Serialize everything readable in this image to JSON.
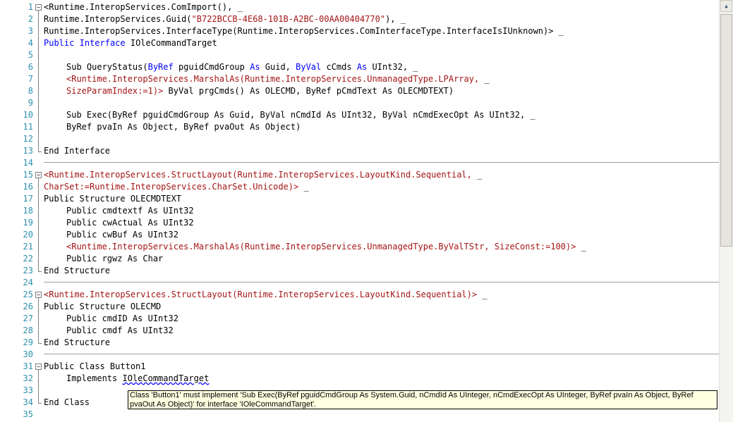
{
  "editor": {
    "lines": [
      {
        "n": "1",
        "text": "<Runtime.InteropServices.ComImport(), _"
      },
      {
        "n": "2",
        "text": "Runtime.InteropServices.Guid(\"B722BCCB-4E68-101B-A2BC-00AA00404770\"), _"
      },
      {
        "n": "3",
        "text": "Runtime.InteropServices.InterfaceType(Runtime.InteropServices.ComInterfaceType.InterfaceIsIUnknown)> _"
      },
      {
        "n": "4",
        "text": "Public Interface IOleCommandTarget"
      },
      {
        "n": "5",
        "text": ""
      },
      {
        "n": "6",
        "text": "Sub QueryStatus(ByRef pguidCmdGroup As Guid, ByVal cCmds As UInt32, _"
      },
      {
        "n": "7",
        "text": "<Runtime.InteropServices.MarshalAs(Runtime.InteropServices.UnmanagedType.LPArray, _"
      },
      {
        "n": "8",
        "text": "SizeParamIndex:=1)> ByVal prgCmds() As OLECMD, ByRef pCmdText As OLECMDTEXT)"
      },
      {
        "n": "9",
        "text": ""
      },
      {
        "n": "10",
        "text": "Sub Exec(ByRef pguidCmdGroup As Guid, ByVal nCmdId As UInt32, ByVal nCmdExecOpt As UInt32, _"
      },
      {
        "n": "11",
        "text": "ByRef pvaIn As Object, ByRef pvaOut As Object)"
      },
      {
        "n": "12",
        "text": ""
      },
      {
        "n": "13",
        "text": "End Interface"
      },
      {
        "n": "14",
        "text": ""
      },
      {
        "n": "15",
        "text": "<Runtime.InteropServices.StructLayout(Runtime.InteropServices.LayoutKind.Sequential, _"
      },
      {
        "n": "16",
        "text": "CharSet:=Runtime.InteropServices.CharSet.Unicode)> _"
      },
      {
        "n": "17",
        "text": "Public Structure OLECMDTEXT"
      },
      {
        "n": "18",
        "text": "Public cmdtextf As UInt32"
      },
      {
        "n": "19",
        "text": "Public cwActual As UInt32"
      },
      {
        "n": "20",
        "text": "Public cwBuf As UInt32"
      },
      {
        "n": "21",
        "text": "<Runtime.InteropServices.MarshalAs(Runtime.InteropServices.UnmanagedType.ByValTStr, SizeConst:=100)> _"
      },
      {
        "n": "22",
        "text": "Public rgwz As Char"
      },
      {
        "n": "23",
        "text": "End Structure"
      },
      {
        "n": "24",
        "text": ""
      },
      {
        "n": "25",
        "text": "<Runtime.InteropServices.StructLayout(Runtime.InteropServices.LayoutKind.Sequential)> _"
      },
      {
        "n": "26",
        "text": "Public Structure OLECMD"
      },
      {
        "n": "27",
        "text": "Public cmdID As UInt32"
      },
      {
        "n": "28",
        "text": "Public cmdf As UInt32"
      },
      {
        "n": "29",
        "text": "End Structure"
      },
      {
        "n": "30",
        "text": ""
      },
      {
        "n": "31",
        "text": "Public Class Button1"
      },
      {
        "n": "32",
        "text": "Implements IOleCommandTarget"
      },
      {
        "n": "33",
        "text": ""
      },
      {
        "n": "34",
        "text": "End Class"
      },
      {
        "n": "35",
        "text": ""
      }
    ]
  },
  "tooltip": {
    "text": "Class 'Button1' must implement 'Sub Exec(ByRef pguidCmdGroup As System.Guid, nCmdId As UInteger, nCmdExecOpt As UInteger, ByRef pvaIn As Object, ByRef pvaOut As Object)' for interface 'IOleCommandTarget'."
  },
  "colors": {
    "keyword": "#0000ff",
    "attribute": "#a31515",
    "line_number": "#2b91af",
    "tooltip_bg": "#ffffe1"
  },
  "icons": [
    "collapse-minus-icon",
    "scroll-up-arrow-icon"
  ]
}
